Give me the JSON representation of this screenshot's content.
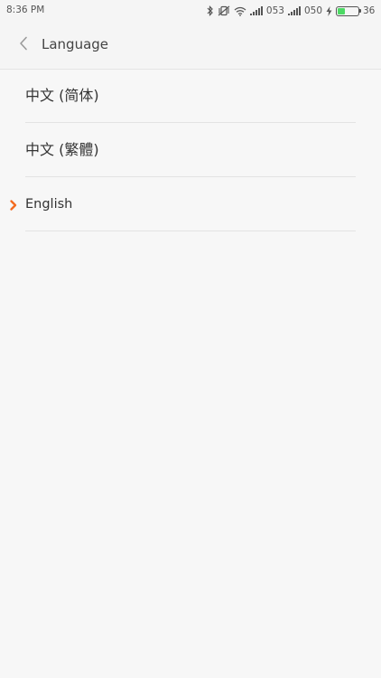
{
  "status_bar": {
    "time": "8:36 PM",
    "signal_1": "053",
    "signal_2": "050",
    "battery_text": "36%",
    "battery_level": 0.36,
    "icons": [
      "bluetooth-icon",
      "vibrate-mute-icon",
      "wifi-icon",
      "signal-icon",
      "signal-icon",
      "charging-icon",
      "battery-icon"
    ]
  },
  "header": {
    "back_icon": "back-chevron-icon",
    "title": "Language"
  },
  "languages": [
    {
      "label": "中文 (简体)",
      "selected": false
    },
    {
      "label": "中文 (繁體)",
      "selected": false
    },
    {
      "label": "English",
      "selected": true
    }
  ],
  "colors": {
    "accent": "#f36c21",
    "background": "#f7f7f7",
    "battery": "#4cd964"
  }
}
